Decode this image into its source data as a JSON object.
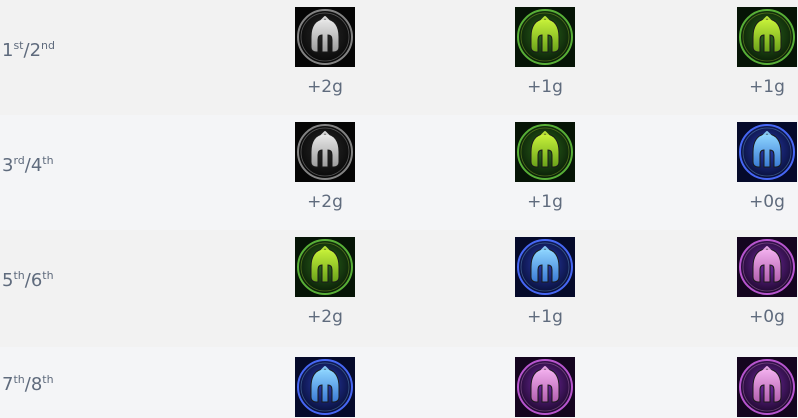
{
  "colors": {
    "silver": "#d9d9d9",
    "gold": "#b6ea2d",
    "prismatic": "#6cc8ff",
    "diamond": "#f0a8e8"
  },
  "rows": [
    {
      "placeA": "1",
      "supA": "st",
      "sep": "/",
      "placeB": "2",
      "supB": "nd",
      "cells": [
        {
          "tier": "silver",
          "gold": "+2g"
        },
        {
          "tier": "green",
          "gold": "+1g"
        },
        {
          "tier": "green",
          "gold": "+1g"
        }
      ]
    },
    {
      "placeA": "3",
      "supA": "rd",
      "sep": "/",
      "placeB": "4",
      "supB": "th",
      "cells": [
        {
          "tier": "silver",
          "gold": "+2g"
        },
        {
          "tier": "green",
          "gold": "+1g"
        },
        {
          "tier": "blue",
          "gold": "+0g"
        }
      ]
    },
    {
      "placeA": "5",
      "supA": "th",
      "sep": "/",
      "placeB": "6",
      "supB": "th",
      "cells": [
        {
          "tier": "green",
          "gold": "+2g"
        },
        {
          "tier": "blue",
          "gold": "+1g"
        },
        {
          "tier": "purple",
          "gold": "+0g"
        }
      ]
    },
    {
      "placeA": "7",
      "supA": "th",
      "sep": "/",
      "placeB": "8",
      "supB": "th",
      "cells": [
        {
          "tier": "blue",
          "gold": ""
        },
        {
          "tier": "purple",
          "gold": ""
        },
        {
          "tier": "purple",
          "gold": ""
        }
      ]
    }
  ]
}
